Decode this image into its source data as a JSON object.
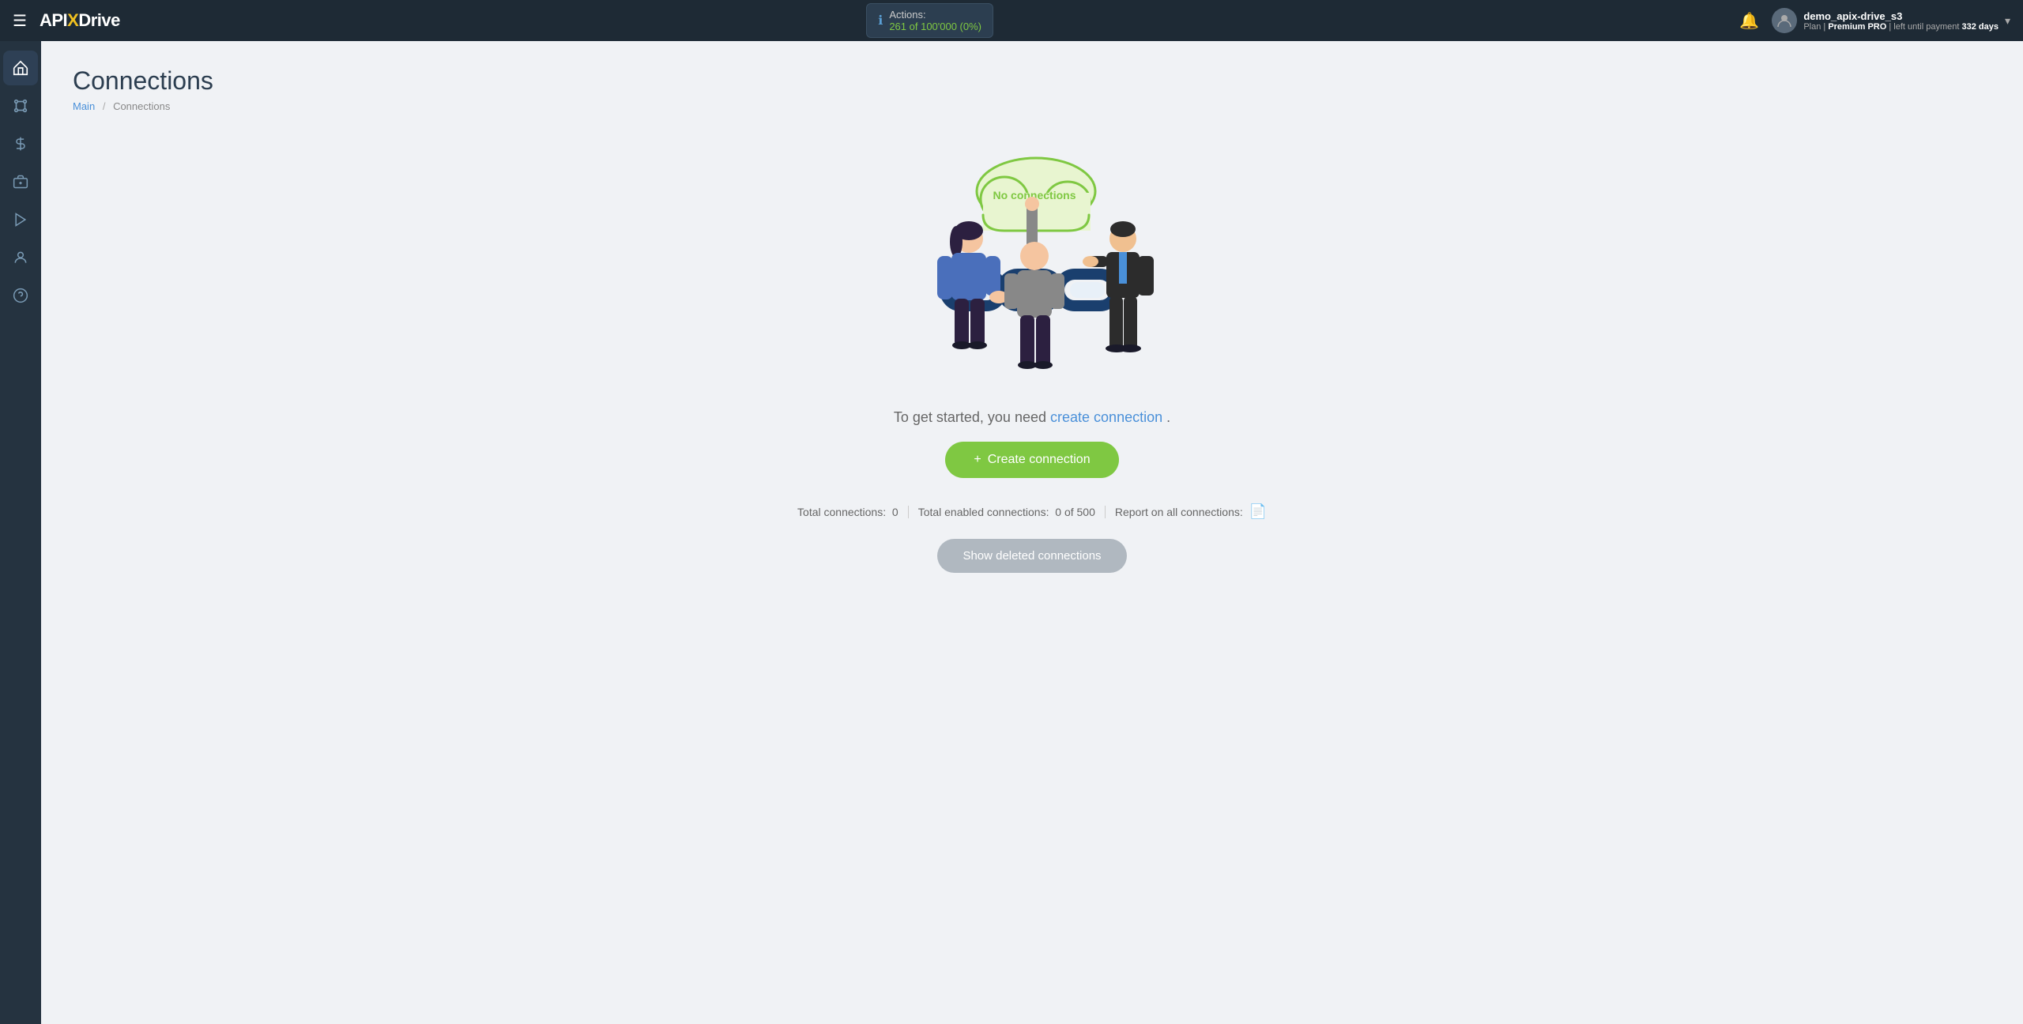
{
  "topnav": {
    "menu_icon": "☰",
    "logo_api": "API",
    "logo_x": "X",
    "logo_drive": "Drive",
    "actions_label": "Actions:",
    "actions_value": "261 of 100'000 (0%)",
    "bell_icon": "🔔",
    "user_name": "demo_apix-drive_s3",
    "user_plan_prefix": "Plan |",
    "user_plan_name": "Premium PRO",
    "user_plan_suffix": "| left until payment",
    "user_plan_days": "332 days",
    "chevron": "▾"
  },
  "sidebar": {
    "items": [
      {
        "icon": "⊞",
        "name": "home"
      },
      {
        "icon": "⠿",
        "name": "connections"
      },
      {
        "icon": "$",
        "name": "billing"
      },
      {
        "icon": "🧰",
        "name": "tools"
      },
      {
        "icon": "▶",
        "name": "media"
      },
      {
        "icon": "👤",
        "name": "profile"
      },
      {
        "icon": "?",
        "name": "help"
      }
    ]
  },
  "page": {
    "title": "Connections",
    "breadcrumb_main": "Main",
    "breadcrumb_sep": "/",
    "breadcrumb_current": "Connections"
  },
  "empty_state": {
    "cloud_label": "No connections",
    "intro_prefix": "To get started, you need",
    "intro_link": "create connection",
    "intro_suffix": ".",
    "create_btn_icon": "+",
    "create_btn_label": "Create connection"
  },
  "stats": {
    "total_connections_label": "Total connections:",
    "total_connections_value": "0",
    "total_enabled_label": "Total enabled connections:",
    "total_enabled_value": "0 of 500",
    "report_label": "Report on all connections:"
  },
  "deleted": {
    "show_deleted_label": "Show deleted connections"
  }
}
